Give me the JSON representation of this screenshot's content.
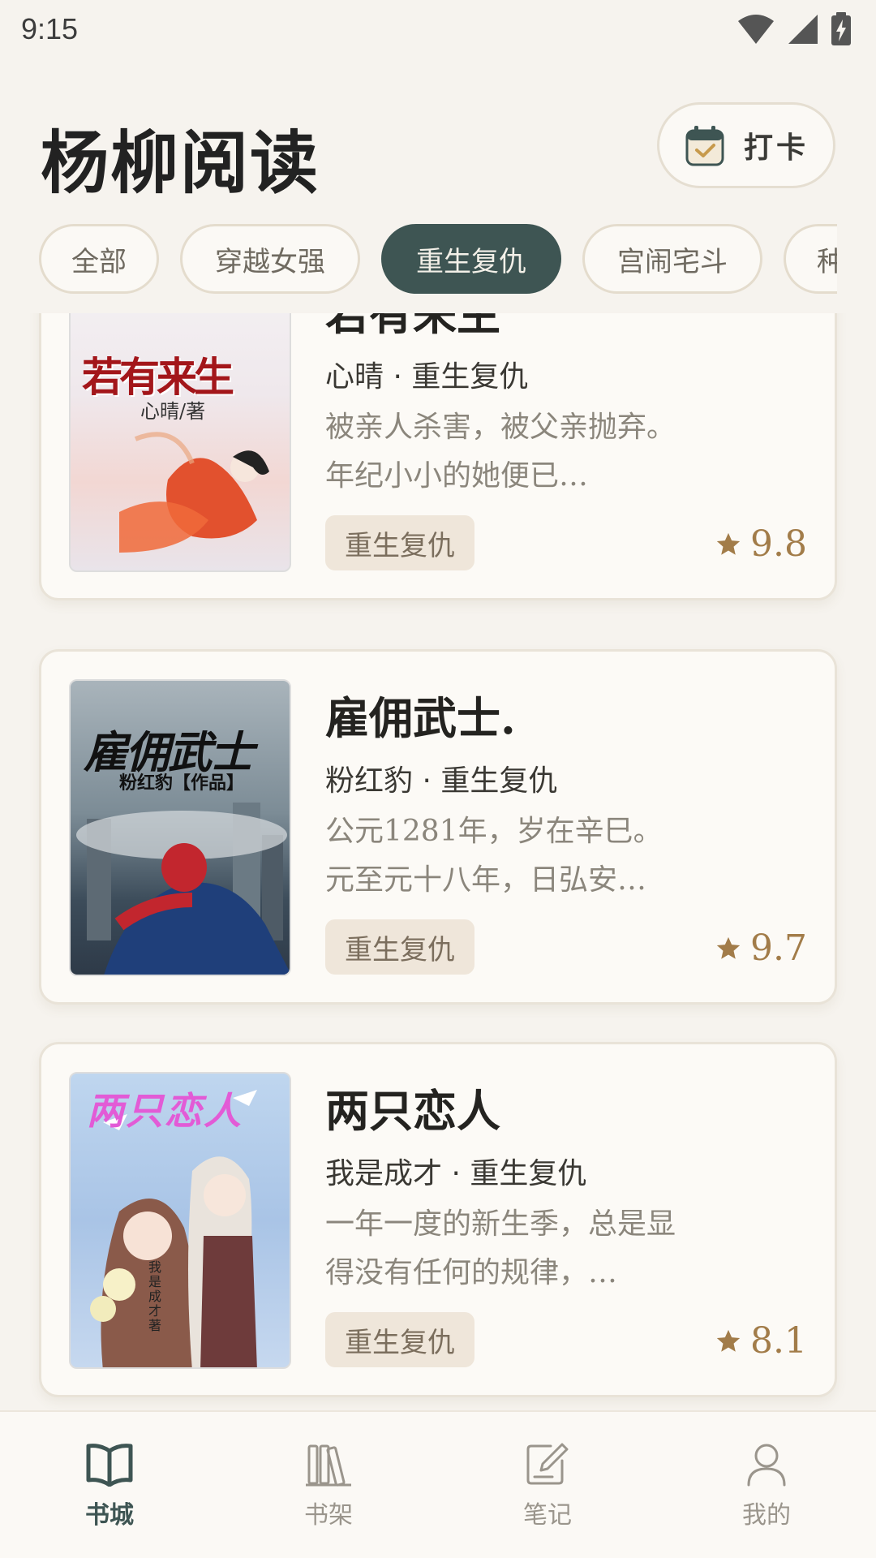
{
  "status": {
    "time": "9:15"
  },
  "header": {
    "title": "杨柳阅读",
    "checkin_label": "打卡"
  },
  "categories": [
    {
      "label": "全部",
      "active": false
    },
    {
      "label": "穿越女强",
      "active": false
    },
    {
      "label": "重生复仇",
      "active": true
    },
    {
      "label": "宫闹宅斗",
      "active": false
    },
    {
      "label": "种田",
      "active": false
    }
  ],
  "books": [
    {
      "title": "若有来生",
      "meta": "心晴 · 重生复仇",
      "description": "被亲人杀害，被父亲抛弃。年纪小小的她便已…",
      "tag": "重生复仇",
      "rating": "9.8",
      "cover_title": "若有来生",
      "cover_author": "心晴/著"
    },
    {
      "title": "雇佣武士.",
      "meta": "粉红豹 · 重生复仇",
      "description": "公元1281年，岁在辛巳。元至元十八年，日弘安…",
      "tag": "重生复仇",
      "rating": "9.7",
      "cover_title": "雇佣武士",
      "cover_author": "粉红豹【作品】"
    },
    {
      "title": "两只恋人",
      "meta": "我是成才 · 重生复仇",
      "description": "一年一度的新生季，总是显得没有任何的规律，…",
      "tag": "重生复仇",
      "rating": "8.1",
      "cover_title": "两只恋人",
      "cover_author": "我是成才著"
    }
  ],
  "nav": [
    {
      "label": "书城",
      "icon": "open-book-icon",
      "active": true
    },
    {
      "label": "书架",
      "icon": "bookshelf-icon",
      "active": false
    },
    {
      "label": "笔记",
      "icon": "note-edit-icon",
      "active": false
    },
    {
      "label": "我的",
      "icon": "user-icon",
      "active": false
    }
  ],
  "colors": {
    "background": "#f6f3ee",
    "accent": "#3e5553",
    "rating": "#a27c49",
    "tag_bg": "#efe6da"
  }
}
